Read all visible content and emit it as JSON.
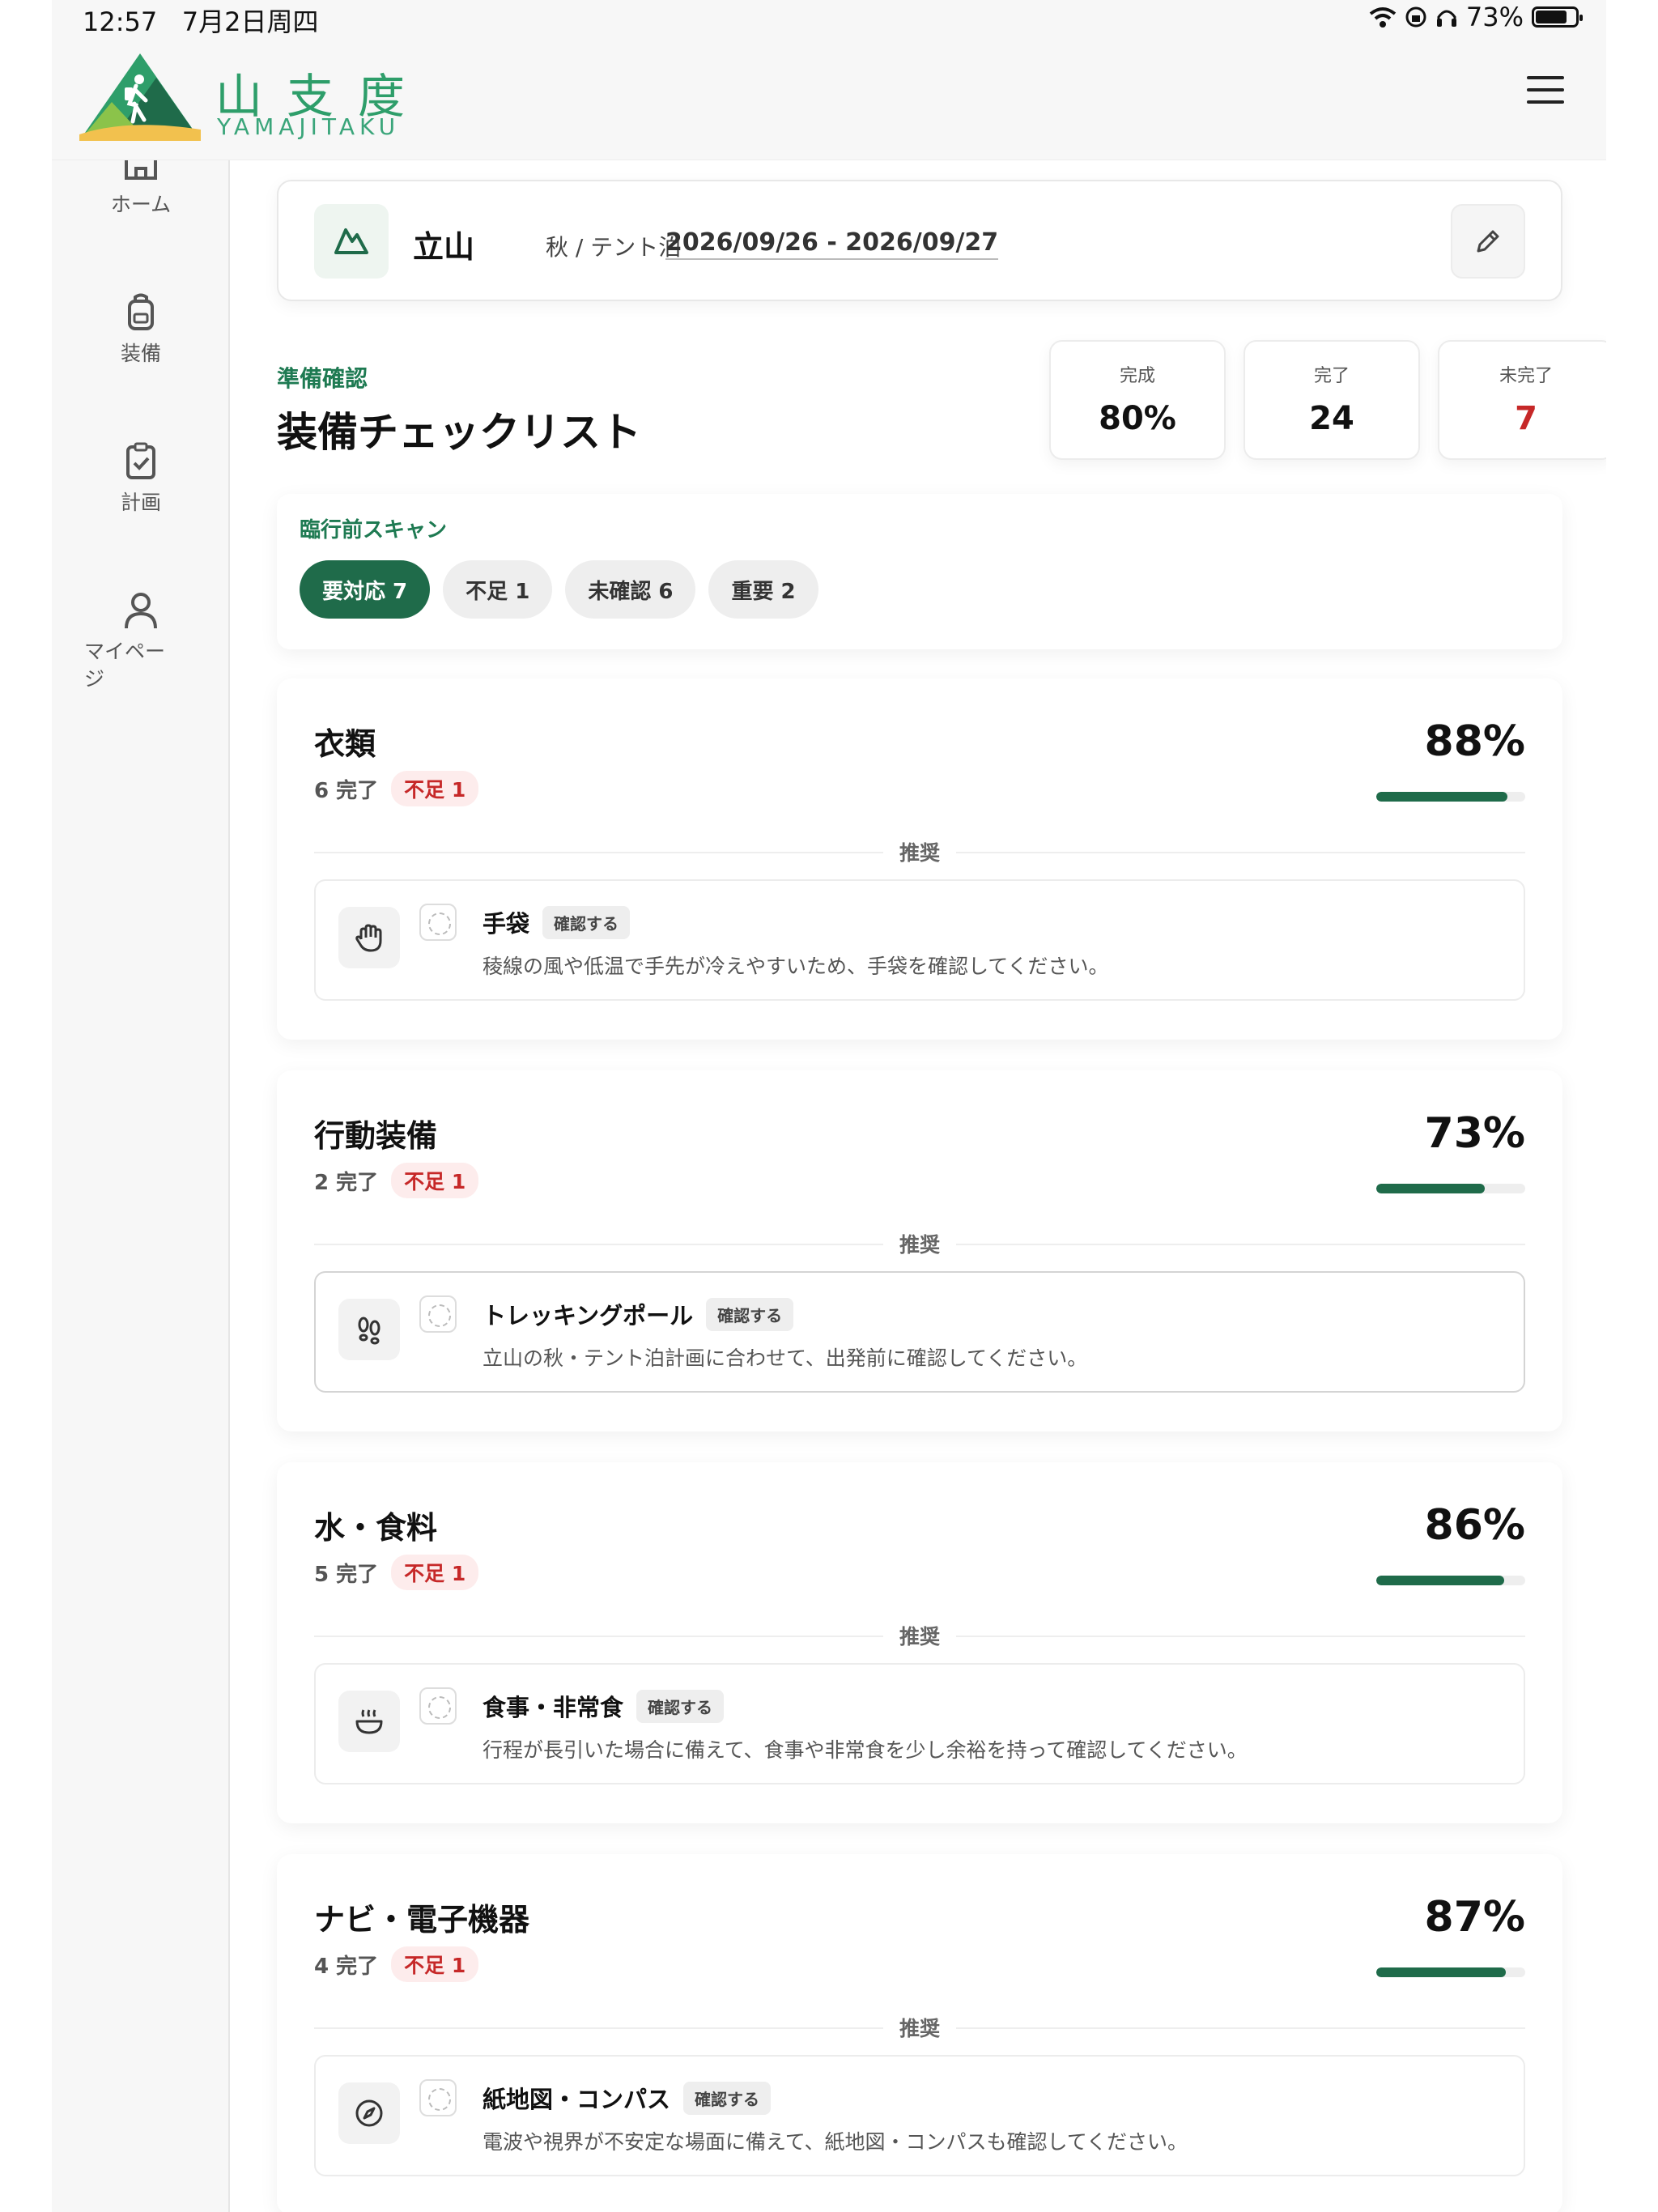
{
  "status": {
    "time": "12:57",
    "date": "7月2日周四",
    "battery": "73%"
  },
  "brand": {
    "kanji": "山支度",
    "roman": "YAMAJITAKU"
  },
  "sidebar": {
    "items": [
      {
        "label": "ホーム",
        "icon": "home-icon"
      },
      {
        "label": "装備",
        "icon": "backpack-icon"
      },
      {
        "label": "計画",
        "icon": "clipboard-check-icon"
      },
      {
        "label": "マイページ",
        "icon": "user-icon"
      }
    ]
  },
  "trip": {
    "name": "立山",
    "meta": "秋 / テント泊",
    "dates": "2026/09/26 - 2026/09/27"
  },
  "page": {
    "eyebrow": "準備確認",
    "title": "装備チェックリスト"
  },
  "stats": [
    {
      "label": "完成",
      "value": "80%"
    },
    {
      "label": "完了",
      "value": "24"
    },
    {
      "label": "未完了",
      "value": "7"
    }
  ],
  "scan": {
    "title": "臨行前スキャン",
    "pills": [
      "要対応 7",
      "不足 1",
      "未確認 6",
      "重要 2"
    ]
  },
  "categories": [
    {
      "title": "衣類",
      "done": "6 完了",
      "shortage": "不足 1",
      "percent": "88%",
      "progress": 0.88,
      "section": "推奨",
      "item": {
        "name": "手袋",
        "tag": "確認する",
        "desc": "稜線の風や低温で手先が冷えやすいため、手袋を確認してください。",
        "icon": "hand-icon"
      }
    },
    {
      "title": "行動装備",
      "done": "2 完了",
      "shortage": "不足 1",
      "percent": "73%",
      "progress": 0.73,
      "section": "推奨",
      "item": {
        "name": "トレッキングポール",
        "tag": "確認する",
        "desc": "立山の秋・テント泊計画に合わせて、出発前に確認してください。",
        "icon": "footprints-icon"
      }
    },
    {
      "title": "水・食料",
      "done": "5 完了",
      "shortage": "不足 1",
      "percent": "86%",
      "progress": 0.86,
      "section": "推奨",
      "item": {
        "name": "食事・非常食",
        "tag": "確認する",
        "desc": "行程が長引いた場合に備えて、食事や非常食を少し余裕を持って確認してください。",
        "icon": "bowl-icon"
      }
    },
    {
      "title": "ナビ・電子機器",
      "done": "4 完了",
      "shortage": "不足 1",
      "percent": "87%",
      "progress": 0.87,
      "section": "推奨",
      "item": {
        "name": "紙地図・コンパス",
        "tag": "確認する",
        "desc": "電波や視界が不安定な場面に備えて、紙地図・コンパスも確認してください。",
        "icon": "compass-icon"
      }
    }
  ],
  "colors": {
    "accent": "#1f6b4a",
    "danger": "#c62828",
    "brand": "#2e9e6a"
  }
}
